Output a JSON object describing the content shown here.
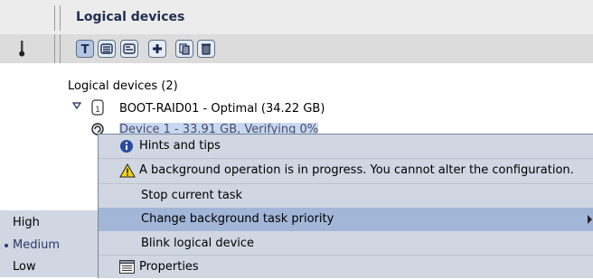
{
  "header": {
    "title": "Logical devices"
  },
  "toolbar": {
    "buttons": [
      {
        "icon": "text-view-icon",
        "glyph": "T"
      },
      {
        "icon": "list-view-icon"
      },
      {
        "icon": "details-view-icon"
      },
      {
        "icon": "add-icon"
      },
      {
        "icon": "copy-icon"
      },
      {
        "icon": "delete-icon"
      }
    ]
  },
  "tree": {
    "heading": "Logical devices (2)",
    "items": [
      {
        "label": "BOOT-RAID01 - Optimal (34.22 GB)",
        "badge": "1"
      },
      {
        "label": "Device 1 - 33.91 GB, Verifying 0%"
      }
    ]
  },
  "context_menu": {
    "items": [
      {
        "label": "Hints and tips",
        "icon": "info-icon"
      },
      {
        "label": "A background operation is in progress.  You cannot alter the configuration.",
        "icon": "warning-icon"
      },
      {
        "label": "Stop current task"
      },
      {
        "label": "Change background task priority",
        "has_submenu": true,
        "highlighted": true
      },
      {
        "label": "Blink logical device"
      },
      {
        "label": "Properties",
        "icon": "properties-icon"
      }
    ]
  },
  "priority_submenu": {
    "options": [
      "High",
      "Medium",
      "Low"
    ],
    "selected": "Medium"
  },
  "colors": {
    "menu_bg": "#d0d7e2",
    "highlight": "#a2b6d8",
    "header_text": "#1f2f4f"
  }
}
